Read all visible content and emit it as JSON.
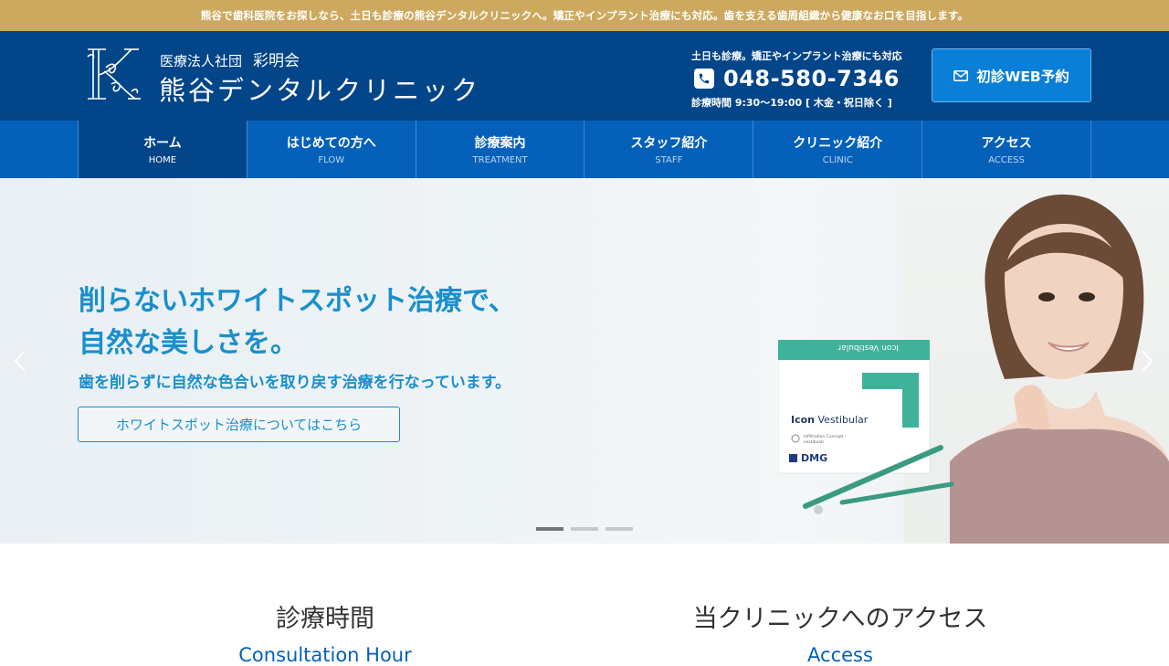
{
  "topbar": {
    "message": "熊谷で歯科医院をお探しなら、土日も診療の熊谷デンタルクリニックへ。矯正やインプラント治療にも対応。歯を支える歯周組織から健康なお口を目指します。"
  },
  "header": {
    "corp_prefix": "医療法人社団",
    "corp_name": "彩明会",
    "clinic_name": "熊谷デンタルクリニック",
    "contact_note": "土日も診療。矯正やインプラント治療にも対応",
    "phone": "048-580-7346",
    "hours": "診療時間 9:30〜19:00 [ 木金・祝日除く ]",
    "web_reserve": "初診WEB予約"
  },
  "nav": {
    "items": [
      {
        "jp": "ホーム",
        "en": "HOME"
      },
      {
        "jp": "はじめての方へ",
        "en": "FLOW"
      },
      {
        "jp": "診療案内",
        "en": "TREATMENT"
      },
      {
        "jp": "スタッフ紹介",
        "en": "STAFF"
      },
      {
        "jp": "クリニック紹介",
        "en": "CLINIC"
      },
      {
        "jp": "アクセス",
        "en": "ACCESS"
      }
    ]
  },
  "hero": {
    "title_line1": "削らないホワイトスポット治療で、",
    "title_line2": "自然な美しさを。",
    "subtitle": "歯を削らずに自然な色合いを取り戻す治療を行なっています。",
    "cta": "ホワイトスポット治療についてはこちら",
    "product": {
      "brand_top": "Icon Vestibular",
      "brand": "Icon",
      "brand_rest": " Vestibular",
      "small1": "Infiltration Concept -",
      "small2": "vestibular",
      "maker": "DMG"
    },
    "slides_total": 3,
    "active_slide": 1
  },
  "sections": {
    "hours_title": "診療時間",
    "hours_en": "Consultation Hour",
    "access_title": "当クリニックへのアクセス",
    "access_en": "Access"
  },
  "colors": {
    "topbar": "#cda960",
    "header": "#034589",
    "nav": "#0560b9",
    "accent": "#1a8fcc",
    "button": "#0a7fd8"
  }
}
